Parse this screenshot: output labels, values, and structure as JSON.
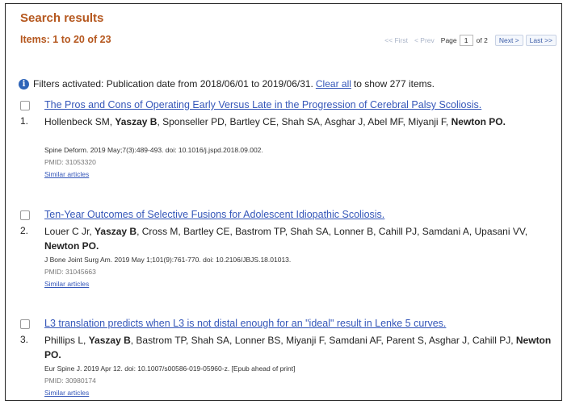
{
  "header": {
    "title": "Search results",
    "items": "Items: 1 to 20 of 23"
  },
  "pager": {
    "first": "<< First",
    "prev": "< Prev",
    "page_label": "Page",
    "page_value": "1",
    "of": "of 2",
    "next": "Next >",
    "last": "Last >>"
  },
  "filters": {
    "text": "Filters activated: Publication date from 2018/06/01 to 2019/06/31.",
    "clear_label": "Clear all",
    "suffix": "to show 277 items."
  },
  "results": [
    {
      "number": "1.",
      "title": "The Pros and Cons of Operating Early Versus Late in the Progression of Cerebral Palsy Scoliosis.",
      "authors_1": "Hollenbeck SM,",
      "authors_bold_1": "Yaszay B",
      "authors_2": ", Sponseller PD, Bartley CE, Shah SA, Asghar J, Abel MF, Miyanji F,",
      "authors_bold_2": "Newton PO",
      "authors_end": ".",
      "citation": "Spine Deform. 2019 May;7(3):489-493. doi: 10.1016/j.jspd.2018.09.002.",
      "pmid": "PMID: 31053320",
      "similar": "Similar articles"
    },
    {
      "number": "2.",
      "title": "Ten-Year Outcomes of Selective Fusions for Adolescent Idiopathic Scoliosis.",
      "authors_1": "Louer C Jr,",
      "authors_bold_1": "Yaszay B",
      "authors_2": ", Cross M, Bartley CE, Bastrom TP, Shah SA, Lonner B, Cahill PJ, Samdani A, Upasani VV,",
      "authors_bold_2": "Newton PO",
      "authors_end": ".",
      "citation": "J Bone Joint Surg Am. 2019 May 1;101(9):761-770. doi: 10.2106/JBJS.18.01013.",
      "pmid": "PMID: 31045663",
      "similar": "Similar articles"
    },
    {
      "number": "3.",
      "title": "L3 translation predicts when L3 is not distal enough for an \"ideal\" result in Lenke 5 curves.",
      "authors_1": "Phillips L,",
      "authors_bold_1": "Yaszay B",
      "authors_2": ", Bastrom TP, Shah SA, Lonner BS, Miyanji F, Samdani AF, Parent S, Asghar J, Cahill PJ,",
      "authors_bold_2": "Newton PO",
      "authors_end": ".",
      "citation": "Eur Spine J. 2019 Apr 12. doi: 10.1007/s00586-019-05960-z. [Epub ahead of print]",
      "pmid": "PMID: 30980174",
      "similar": "Similar articles"
    }
  ],
  "colors": {
    "heading": "#b5571e",
    "link": "#3557b9",
    "info_icon": "#2e64b8"
  },
  "icons": {
    "info": "info-icon"
  }
}
